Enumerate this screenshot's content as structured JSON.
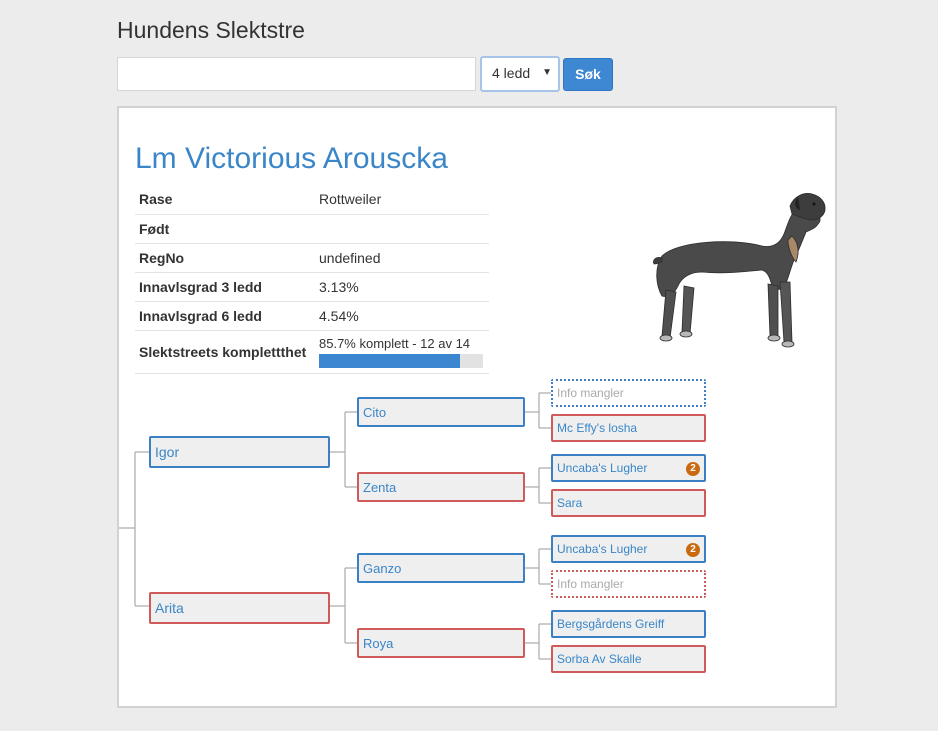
{
  "page": {
    "title": "Hundens Slektstre"
  },
  "search": {
    "value": "",
    "placeholder": ""
  },
  "generations": {
    "selected": "4 ledd"
  },
  "search_button": {
    "label": "Søk"
  },
  "dog": {
    "name": "Lm Victorious Arouscka",
    "info": [
      {
        "key": "Rase",
        "value": "Rottweiler"
      },
      {
        "key": "Født",
        "value": ""
      },
      {
        "key": "RegNo",
        "value": "undefined"
      },
      {
        "key": "Innavlsgrad 3 ledd",
        "value": "3.13%"
      },
      {
        "key": "Innavlsgrad 6 ledd",
        "value": "4.54%"
      }
    ],
    "completeness": {
      "label": "Slektstreets komplettthet",
      "text": "85.7% komplett - 12 av 14",
      "percent": 85.7
    }
  },
  "pedigree": {
    "sire": {
      "name": "Igor",
      "sex": "male"
    },
    "dam": {
      "name": "Arita",
      "sex": "female"
    },
    "sire_sire": {
      "name": "Cito",
      "sex": "male"
    },
    "sire_dam": {
      "name": "Zenta",
      "sex": "female"
    },
    "dam_sire": {
      "name": "Ganzo",
      "sex": "male"
    },
    "dam_dam": {
      "name": "Roya",
      "sex": "female"
    },
    "gen3": [
      {
        "name": "Info mangler",
        "sex": "male",
        "missing": true,
        "badge": ""
      },
      {
        "name": "Mc Effy's losha",
        "sex": "female",
        "missing": false,
        "badge": ""
      },
      {
        "name": "Uncaba's Lugher",
        "sex": "male",
        "missing": false,
        "badge": "2"
      },
      {
        "name": "Sara",
        "sex": "female",
        "missing": false,
        "badge": ""
      },
      {
        "name": "Uncaba's Lugher",
        "sex": "male",
        "missing": false,
        "badge": "2"
      },
      {
        "name": "Info mangler",
        "sex": "female",
        "missing": true,
        "badge": ""
      },
      {
        "name": "Bergsgårdens Greiff",
        "sex": "male",
        "missing": false,
        "badge": ""
      },
      {
        "name": "Sorba Av Skalle",
        "sex": "female",
        "missing": false,
        "badge": ""
      }
    ]
  },
  "icons": {
    "dog_image": "rottweiler-illustration",
    "select_arrow": "caret-down-icon"
  }
}
